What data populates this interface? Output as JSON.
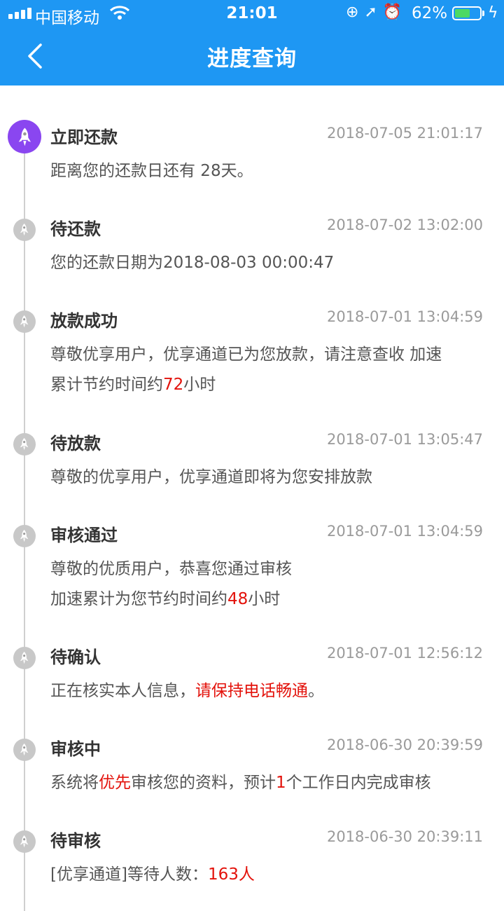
{
  "status_bar": {
    "carrier": "中国移动",
    "time": "21:01",
    "battery": "62%",
    "battery_level": 0.62,
    "battery_color": "#4cd964"
  },
  "header": {
    "title": "进度查询",
    "background_color": "#1e97f3",
    "back_icon": "chevron-left-icon"
  },
  "timeline": [
    {
      "title": "立即还款",
      "time": "2018-07-05 21:01:17",
      "active": true,
      "body": [
        [
          {
            "text": "距离您的还款日还有 28天。"
          }
        ]
      ]
    },
    {
      "title": "待还款",
      "time": "2018-07-02 13:02:00",
      "body": [
        [
          {
            "text": "您的还款日期为2018-08-03 00:00:47"
          }
        ]
      ]
    },
    {
      "title": "放款成功",
      "time": "2018-07-01 13:04:59",
      "body": [
        [
          {
            "text": "尊敬优享用户，优享通道已为您放款，请注意查收 加速"
          }
        ],
        [
          {
            "text": "累计节约时间约"
          },
          {
            "text": "72",
            "red": true
          },
          {
            "text": "小时"
          }
        ]
      ]
    },
    {
      "title": "待放款",
      "time": "2018-07-01 13:05:47",
      "body": [
        [
          {
            "text": "尊敬的优享用户，优享通道即将为您安排放款"
          }
        ]
      ]
    },
    {
      "title": "审核通过",
      "time": "2018-07-01 13:04:59",
      "body": [
        [
          {
            "text": "尊敬的优质用户，恭喜您通过审核"
          }
        ],
        [
          {
            "text": "加速累计为您节约时间约"
          },
          {
            "text": "48",
            "red": true
          },
          {
            "text": "小时"
          }
        ]
      ]
    },
    {
      "title": "待确认",
      "time": "2018-07-01 12:56:12",
      "body": [
        [
          {
            "text": "正在核实本人信息，"
          },
          {
            "text": "请保持电话畅通",
            "red": true
          },
          {
            "text": "。"
          }
        ]
      ]
    },
    {
      "title": "审核中",
      "time": "2018-06-30 20:39:59",
      "body": [
        [
          {
            "text": "系统将"
          },
          {
            "text": "优先",
            "red": true
          },
          {
            "text": "审核您的资料，预计"
          },
          {
            "text": "1",
            "red": true
          },
          {
            "text": "个工作日内完成审核"
          }
        ]
      ]
    },
    {
      "title": "待审核",
      "time": "2018-06-30 20:39:11",
      "body": [
        [
          {
            "text": "[优享通道]等待人数："
          },
          {
            "text": "163人",
            "red": true
          }
        ]
      ]
    }
  ],
  "colors": {
    "highlight": "#e3120b",
    "active_dot": "#8a46f0",
    "inactive_dot": "#c8c8c8"
  }
}
